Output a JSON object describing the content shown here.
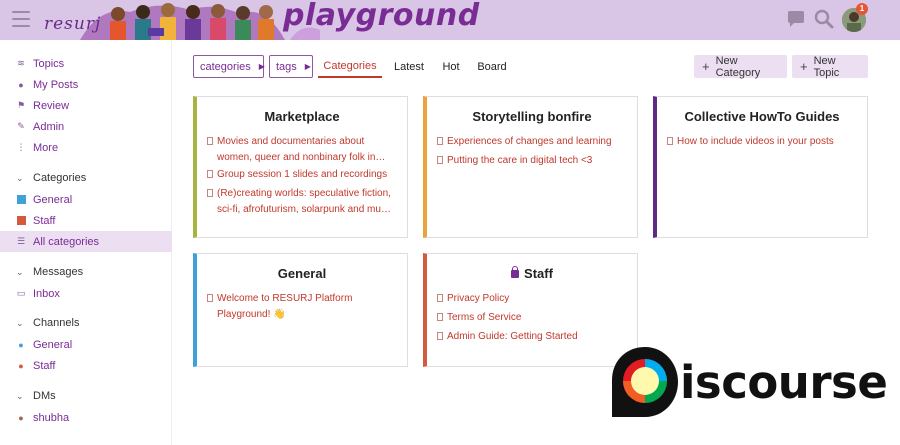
{
  "header": {
    "brand_left": "resurj",
    "brand_title": "playground",
    "notification_count": "1",
    "accent": "#7a2c95",
    "header_bg": "#d9c6e6"
  },
  "sidebar": {
    "items": [
      {
        "label": "Topics",
        "icon": "topics-icon"
      },
      {
        "label": "My Posts",
        "icon": "user-icon"
      },
      {
        "label": "Review",
        "icon": "flag-icon"
      },
      {
        "label": "Admin",
        "icon": "wrench-icon"
      },
      {
        "label": "More",
        "icon": "more-icon"
      }
    ],
    "categories_header": "Categories",
    "categories": [
      {
        "label": "General",
        "color": "#3fa1d8"
      },
      {
        "label": "Staff",
        "color": "#d3593f"
      },
      {
        "label": "All categories",
        "active": true
      }
    ],
    "messages_header": "Messages",
    "messages": [
      {
        "label": "Inbox"
      }
    ],
    "channels_header": "Channels",
    "channels": [
      {
        "label": "General"
      },
      {
        "label": "Staff"
      }
    ],
    "dms_header": "DMs",
    "dms": [
      {
        "label": "shubha"
      }
    ]
  },
  "nav": {
    "categories_dropdown": "categories",
    "tags_dropdown": "tags",
    "tabs": [
      "Categories",
      "Latest",
      "Hot",
      "Board"
    ],
    "active_tab": "Categories",
    "new_category": "New Category",
    "new_topic": "New Topic"
  },
  "cards": [
    {
      "title": "Marketplace",
      "color": "#a6b541",
      "topics": [
        "Movies and documentaries about women, queer and nonbinary folk in…",
        "Group session 1 slides and recordings",
        "(Re)creating worlds: speculative fiction, sci-fi, afrofuturism, solarpunk and mu…"
      ]
    },
    {
      "title": "Storytelling bonfire",
      "color": "#e9a440",
      "topics": [
        "Experiences of changes and learning",
        "Putting the care in digital tech <3"
      ]
    },
    {
      "title": "Collective HowTo Guides",
      "color": "#5e2a86",
      "topics": [
        "How to include videos in your posts"
      ]
    },
    {
      "title": "General",
      "color": "#3fa1d8",
      "topics": [
        "Welcome to RESURJ Platform Playground! 👋"
      ]
    },
    {
      "title": "Staff",
      "color": "#d3593f",
      "locked": true,
      "topics": [
        "Privacy Policy",
        "Terms of Service",
        "Admin Guide: Getting Started"
      ]
    }
  ],
  "logo": {
    "wordmark": "iscourse",
    "colors": [
      "#fff9ae",
      "#00aeef",
      "#00a94f",
      "#f15d22",
      "#e31b23"
    ]
  }
}
